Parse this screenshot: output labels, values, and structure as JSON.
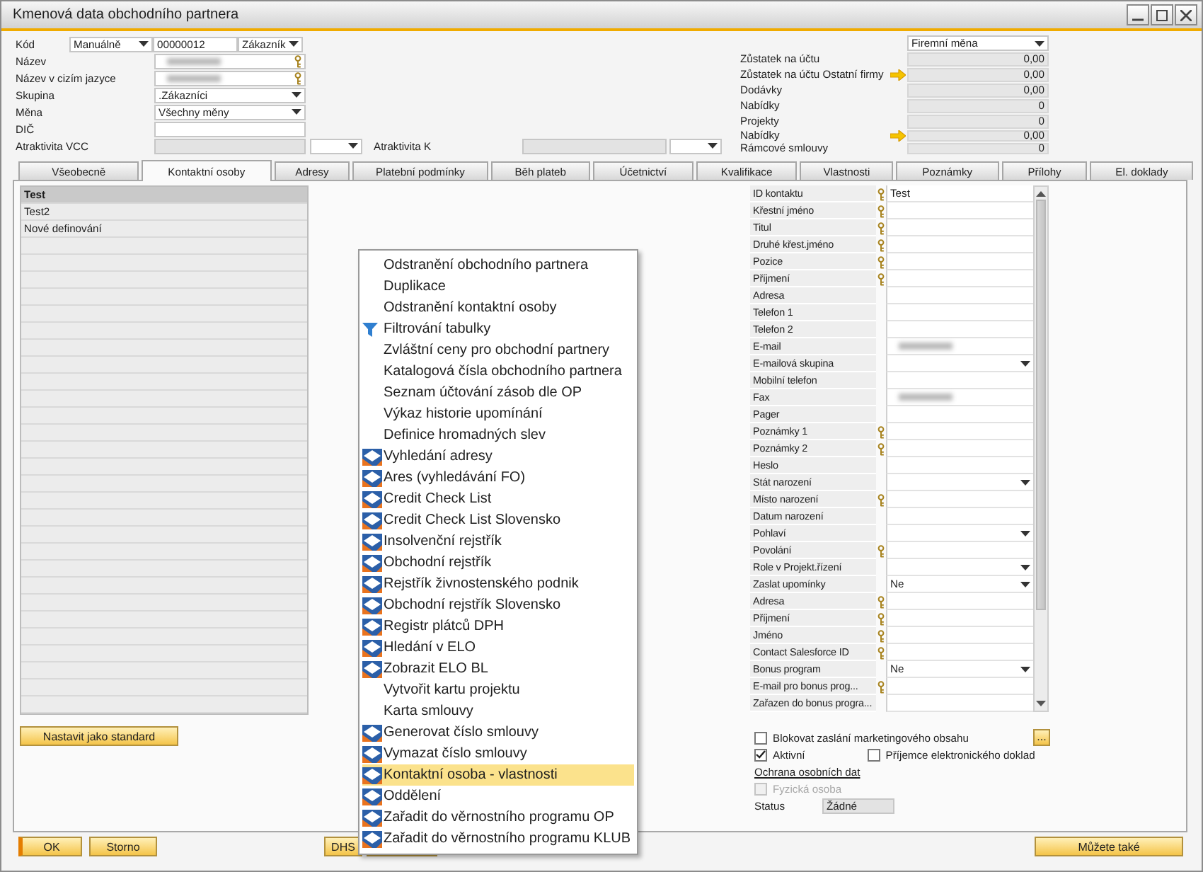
{
  "window": {
    "title": "Kmenová data obchodního partnera"
  },
  "header": {
    "code": {
      "label": "Kód",
      "series": "Manuálně",
      "number": "00000012",
      "type": "Zákazník"
    },
    "fields": [
      {
        "label": "Název",
        "kind": "text",
        "blurred": true,
        "key": true
      },
      {
        "label": "Název v cizím jazyce",
        "kind": "text",
        "blurred": true,
        "key": true
      },
      {
        "label": "Skupina",
        "kind": "select",
        "value": ".Zákazníci",
        "blurred": false,
        "key": false
      },
      {
        "label": "Měna",
        "kind": "select",
        "value": "Všechny měny",
        "blurred": false,
        "key": false
      },
      {
        "label": "DIČ",
        "kind": "text",
        "blurred": false,
        "key": false
      }
    ],
    "attractiveness": [
      {
        "label": "Atraktivita VCC"
      },
      {
        "label": "Atraktivita K"
      }
    ],
    "currency": "Firemní měna",
    "balances": [
      {
        "label": "Zůstatek na účtu",
        "value": "0,00",
        "link": false,
        "compact": false
      },
      {
        "label": "Zůstatek na účtu Ostatní firmy",
        "value": "0,00",
        "link": true,
        "compact": false
      },
      {
        "label": "Dodávky",
        "value": "0,00",
        "link": false,
        "compact": false
      },
      {
        "label": "Nabídky",
        "value": "0",
        "link": false,
        "compact": false
      },
      {
        "label": "Projekty",
        "value": "0",
        "link": false,
        "compact": false
      },
      {
        "label": "Nabídky",
        "value": "0,00",
        "link": true,
        "compact": true
      },
      {
        "label": "Rámcové smlouvy",
        "value": "0",
        "link": false,
        "compact": true
      }
    ]
  },
  "tabs": [
    {
      "label": "Všeobecně",
      "selected": false
    },
    {
      "label": "Kontaktní osoby",
      "selected": true
    },
    {
      "label": "Adresy",
      "selected": false
    },
    {
      "label": "Platební podmínky",
      "selected": false
    },
    {
      "label": "Běh plateb",
      "selected": false
    },
    {
      "label": "Účetnictví",
      "selected": false
    },
    {
      "label": "Kvalifikace",
      "selected": false
    },
    {
      "label": "Vlastnosti",
      "selected": false
    },
    {
      "label": "Poznámky",
      "selected": false
    },
    {
      "label": "Přílohy",
      "selected": false
    },
    {
      "label": "El. doklady",
      "selected": false
    }
  ],
  "contacts": [
    {
      "name": "Test",
      "selected": true
    },
    {
      "name": "Test2",
      "selected": false
    },
    {
      "name": "Nové definování",
      "selected": false
    }
  ],
  "set_default_button": "Nastavit jako standard",
  "contact_fields": [
    {
      "label": "ID kontaktu",
      "key": true,
      "kind": "text",
      "value": "Test",
      "blurred": false
    },
    {
      "label": "Křestní jméno",
      "key": true,
      "kind": "text",
      "blurred": false
    },
    {
      "label": "Titul",
      "key": true,
      "kind": "text",
      "blurred": false
    },
    {
      "label": "Druhé křest.jméno",
      "key": true,
      "kind": "text",
      "blurred": false
    },
    {
      "label": "Pozice",
      "key": true,
      "kind": "text",
      "blurred": false
    },
    {
      "label": "Příjmení",
      "key": true,
      "kind": "text",
      "blurred": false
    },
    {
      "label": "Adresa",
      "key": false,
      "kind": "text",
      "blurred": false
    },
    {
      "label": "Telefon 1",
      "key": false,
      "kind": "text",
      "blurred": false
    },
    {
      "label": "Telefon 2",
      "key": false,
      "kind": "text",
      "blurred": false
    },
    {
      "label": "E-mail",
      "key": false,
      "kind": "text",
      "blurred": true
    },
    {
      "label": "E-mailová skupina",
      "key": false,
      "kind": "select",
      "blurred": false
    },
    {
      "label": "Mobilní telefon",
      "key": false,
      "kind": "text",
      "blurred": false
    },
    {
      "label": "Fax",
      "key": false,
      "kind": "text",
      "blurred": true
    },
    {
      "label": "Pager",
      "key": false,
      "kind": "text",
      "blurred": false
    },
    {
      "label": "Poznámky 1",
      "key": true,
      "kind": "text",
      "blurred": false
    },
    {
      "label": "Poznámky 2",
      "key": true,
      "kind": "text",
      "blurred": false
    },
    {
      "label": "Heslo",
      "key": false,
      "kind": "text",
      "blurred": false
    },
    {
      "label": "Stát narození",
      "key": false,
      "kind": "select",
      "blurred": false
    },
    {
      "label": "Místo narození",
      "key": true,
      "kind": "text",
      "blurred": false
    },
    {
      "label": "Datum narození",
      "key": false,
      "kind": "text",
      "blurred": false
    },
    {
      "label": "Pohlaví",
      "key": false,
      "kind": "select",
      "blurred": false
    },
    {
      "label": "Povolání",
      "key": true,
      "kind": "text",
      "blurred": false
    },
    {
      "label": "Role v Projekt.řízení",
      "key": false,
      "kind": "select",
      "blurred": false
    },
    {
      "label": "Zaslat upomínky",
      "key": false,
      "kind": "select",
      "value": "Ne",
      "blurred": false
    },
    {
      "label": "Adresa",
      "key": true,
      "kind": "text",
      "blurred": false
    },
    {
      "label": "Příjmení",
      "key": true,
      "kind": "text",
      "blurred": false
    },
    {
      "label": "Jméno",
      "key": true,
      "kind": "text",
      "blurred": false
    },
    {
      "label": "Contact Salesforce ID",
      "key": true,
      "kind": "text",
      "blurred": false
    },
    {
      "label": "Bonus program",
      "key": false,
      "kind": "select",
      "value": "Ne",
      "blurred": false
    },
    {
      "label": "E-mail pro bonus prog...",
      "key": true,
      "kind": "text",
      "blurred": false
    },
    {
      "label": "Zařazen do bonus progra...",
      "key": false,
      "kind": "text",
      "blurred": false
    }
  ],
  "options": {
    "block_marketing": {
      "label": "Blokovat zaslání marketingového obsahu",
      "checked": false
    },
    "more_button": "...",
    "active": {
      "label": "Aktivní",
      "checked": true
    },
    "e_invoice_recipient": {
      "label": "Příjemce elektronického doklad",
      "checked": false
    },
    "privacy_link": "Ochrana osobních dat",
    "natural_person": {
      "label": "Fyzická osoba",
      "checked": false,
      "disabled": true
    },
    "status": {
      "label": "Status",
      "value": "Žádné"
    }
  },
  "footer": {
    "ok": "OK",
    "cancel": "Storno",
    "dhs": "DHS",
    "more": "Můžete také"
  },
  "menu": {
    "items": [
      {
        "label": "Odstranění obchodního partnera",
        "kind": "plain",
        "selected": false
      },
      {
        "label": "Duplikace",
        "kind": "plain",
        "selected": false
      },
      {
        "label": "Odstranění kontaktní osoby",
        "kind": "plain",
        "selected": false
      },
      {
        "label": "Filtrování tabulky",
        "kind": "filter",
        "selected": false
      },
      {
        "label": "Zvláštní ceny pro obchodní partnery",
        "kind": "plain",
        "selected": false
      },
      {
        "label": "Katalogová čísla obchodního partnera",
        "kind": "plain",
        "selected": false
      },
      {
        "label": "Seznam účtování zásob dle OP",
        "kind": "plain",
        "selected": false
      },
      {
        "label": "Výkaz historie upomínání",
        "kind": "plain",
        "selected": false
      },
      {
        "label": "Definice hromadných slev",
        "kind": "plain",
        "selected": false
      },
      {
        "label": "Vyhledání adresy",
        "kind": "addon",
        "selected": false
      },
      {
        "label": "Ares (vyhledávání FO)",
        "kind": "addon",
        "selected": false
      },
      {
        "label": "Credit Check List",
        "kind": "addon",
        "selected": false
      },
      {
        "label": "Credit Check List Slovensko",
        "kind": "addon",
        "selected": false
      },
      {
        "label": "Insolvenční rejstřík",
        "kind": "addon",
        "selected": false
      },
      {
        "label": "Obchodní rejstřík",
        "kind": "addon",
        "selected": false
      },
      {
        "label": "Rejstřík živnostenského podnik",
        "kind": "addon",
        "selected": false
      },
      {
        "label": "Obchodní rejstřík Slovensko",
        "kind": "addon",
        "selected": false
      },
      {
        "label": "Registr plátců DPH",
        "kind": "addon",
        "selected": false
      },
      {
        "label": "Hledání v ELO",
        "kind": "addon",
        "selected": false
      },
      {
        "label": "Zobrazit ELO BL",
        "kind": "addon",
        "selected": false
      },
      {
        "label": "Vytvořit kartu projektu",
        "kind": "plain",
        "selected": false
      },
      {
        "label": "Karta smlouvy",
        "kind": "plain",
        "selected": false
      },
      {
        "label": "Generovat číslo smlouvy",
        "kind": "addon",
        "selected": false
      },
      {
        "label": "Vymazat číslo smlouvy",
        "kind": "addon",
        "selected": false
      },
      {
        "label": "Kontaktní osoba - vlastnosti",
        "kind": "addon",
        "selected": true
      },
      {
        "label": "Oddělení",
        "kind": "addon",
        "selected": false
      },
      {
        "label": "Zařadit do věrnostního programu OP",
        "kind": "addon",
        "selected": false
      },
      {
        "label": "Zařadit do věrnostního programu KLUB",
        "kind": "addon",
        "selected": false
      }
    ]
  }
}
